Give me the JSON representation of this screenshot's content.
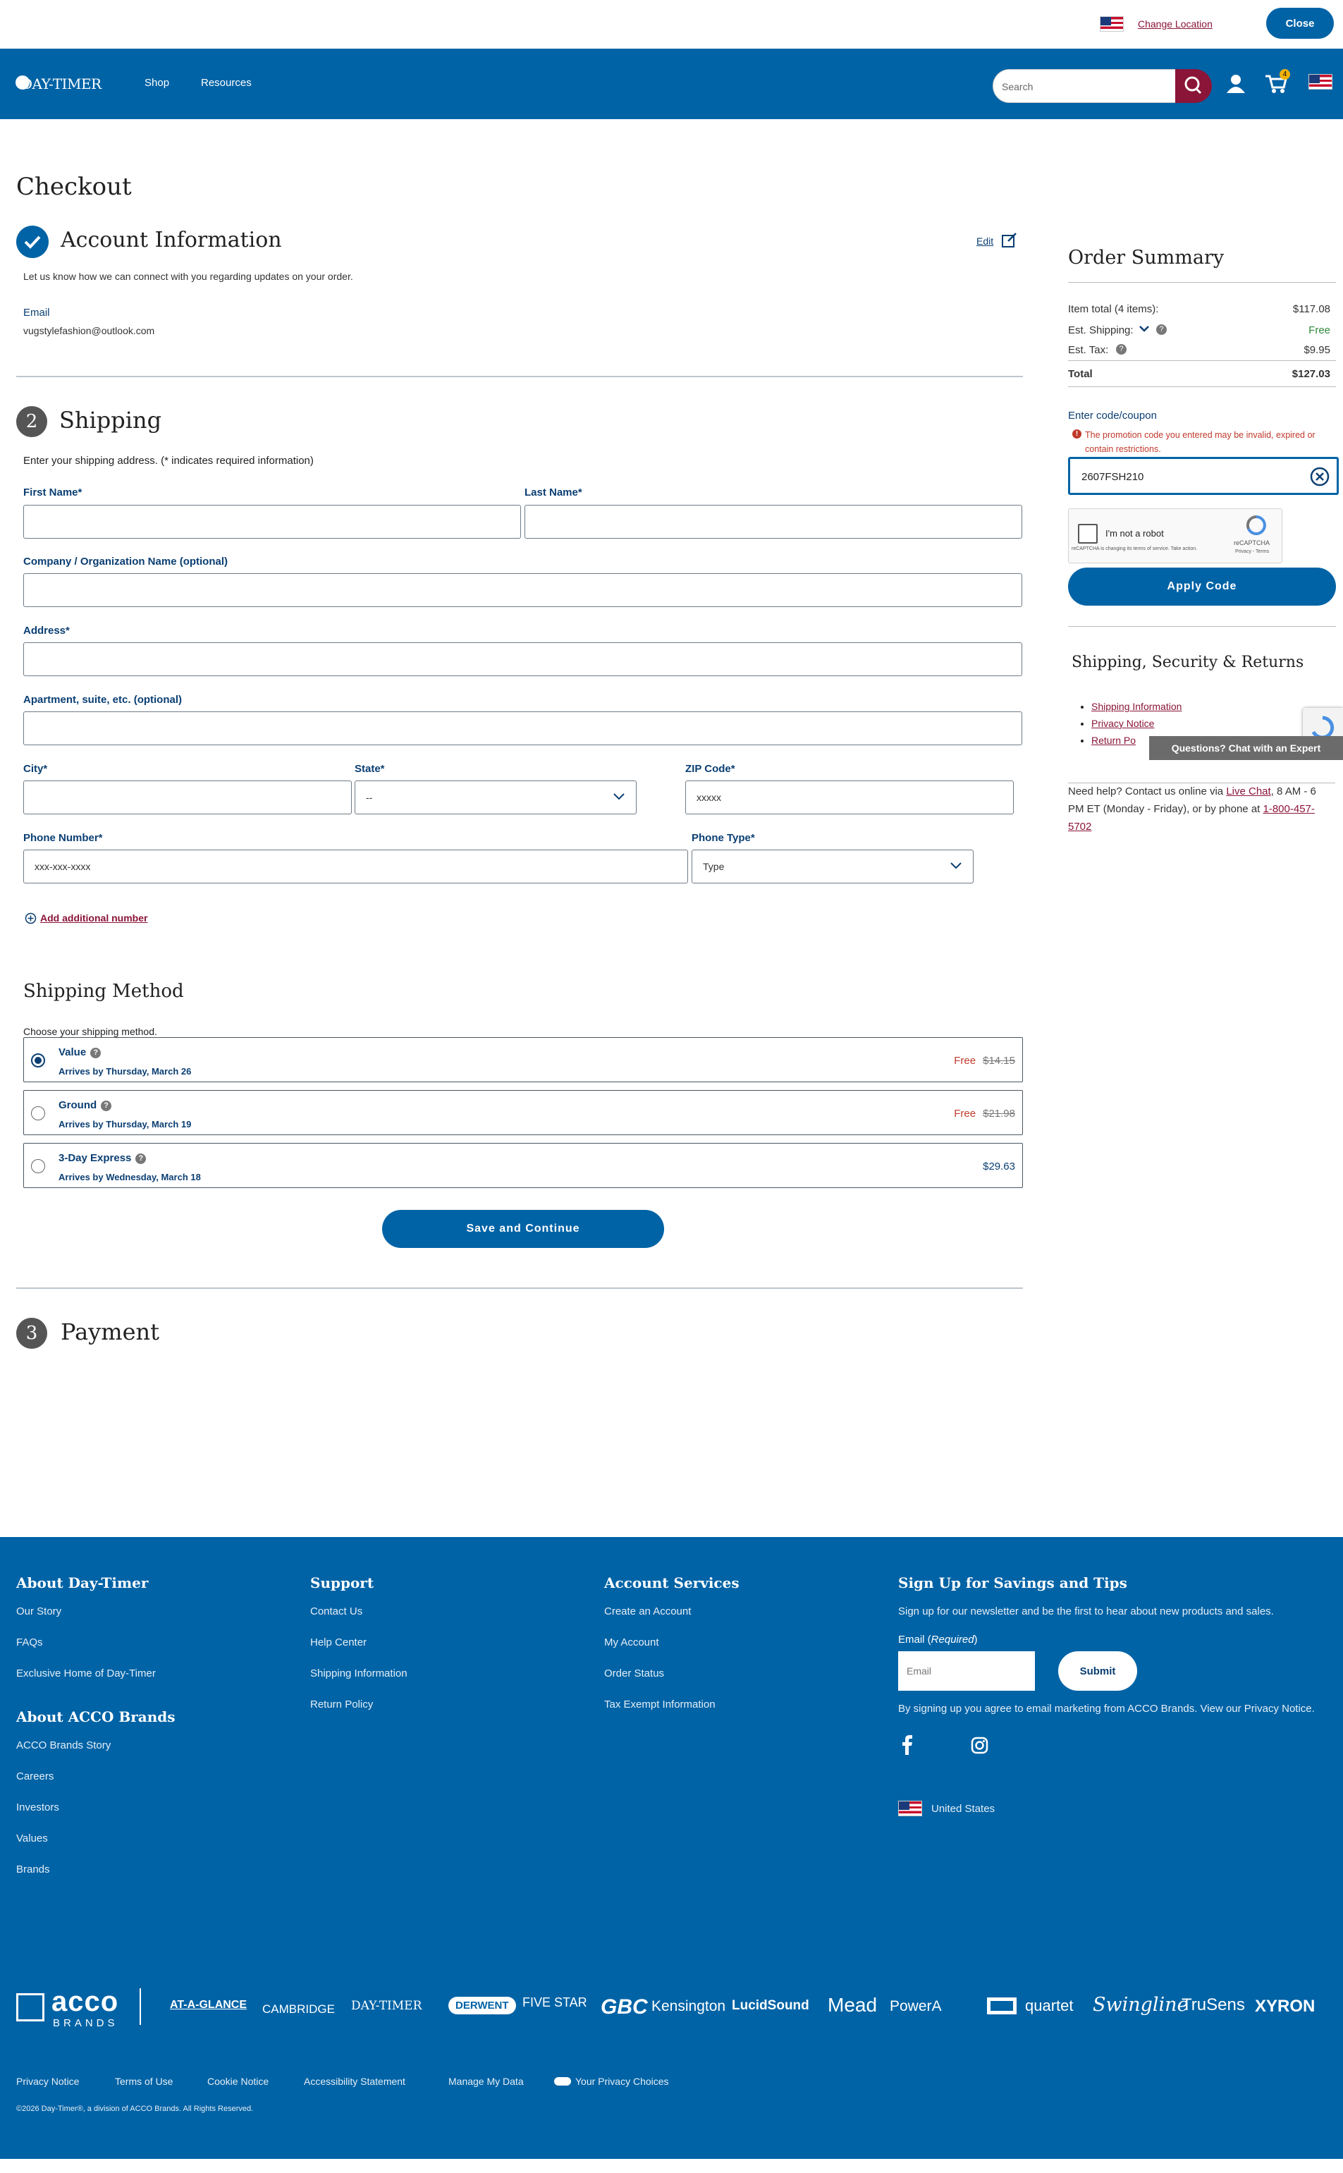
{
  "topbar": {
    "change_location": "Change Location",
    "close": "Close"
  },
  "nav": {
    "logo": "DAY-TIMER",
    "shop": "Shop",
    "resources": "Resources",
    "search_placeholder": "Search",
    "cart_count": "4"
  },
  "page_title": "Checkout",
  "account": {
    "title": "Account Information",
    "edit": "Edit",
    "intro": "Let us know how we can connect with you regarding updates on your order.",
    "email_label": "Email",
    "email_value": "vugstylefashion@outlook.com"
  },
  "shipping": {
    "step": "2",
    "title": "Shipping",
    "intro": "Enter your shipping address. (* indicates required information)",
    "first_name": "First Name*",
    "last_name": "Last Name*",
    "company": "Company / Organization Name (optional)",
    "address": "Address*",
    "apartment": "Apartment, suite, etc. (optional)",
    "city": "City*",
    "state": "State*",
    "state_value": "--",
    "zip": "ZIP Code*",
    "zip_placeholder": "xxxxx",
    "phone": "Phone Number*",
    "phone_placeholder": "xxx-xxx-xxxx",
    "phone_type": "Phone Type*",
    "phone_type_value": "Type",
    "add_number": "Add additional number"
  },
  "shipping_method": {
    "title": "Shipping Method",
    "intro": "Choose your shipping method.",
    "methods": [
      {
        "name": "Value",
        "arrives": "Arrives by Thursday, March 26",
        "free": "Free",
        "old_price": "$14.15",
        "selected": true
      },
      {
        "name": "Ground",
        "arrives": "Arrives by Thursday, March 19",
        "free": "Free",
        "old_price": "$21.98",
        "selected": false
      },
      {
        "name": "3-Day Express",
        "arrives": "Arrives by Wednesday, March 18",
        "price": "$29.63",
        "selected": false
      }
    ],
    "save": "Save and Continue"
  },
  "payment": {
    "step": "3",
    "title": "Payment"
  },
  "summary": {
    "title": "Order Summary",
    "rows": [
      {
        "label": "Item total (4 items):",
        "value": "$117.08"
      },
      {
        "label": "Est. Shipping:",
        "value": "Free"
      },
      {
        "label": "Est. Tax:",
        "value": "$9.95"
      },
      {
        "label": "Total",
        "value": "$127.03"
      }
    ],
    "coupon_label": "Enter code/coupon",
    "coupon_error": "The promotion code you entered may be invalid, expired or contain restrictions.",
    "coupon_value": "2607FSH210",
    "captcha_label": "I'm not a robot",
    "captcha_brand": "reCAPTCHA",
    "captcha_note": "reCAPTCHA is changing its terms of service. Take action.",
    "captcha_links": "Privacy - Terms",
    "apply": "Apply Code",
    "ssr_title": "Shipping, Security & Returns",
    "ssr_links": [
      "Shipping Information",
      "Privacy Notice",
      "Return Po"
    ],
    "chat": "Questions? Chat with an Expert",
    "help_pre": "Need help? Contact us online via ",
    "help_live": "Live Chat",
    "help_mid": ", 8 AM - 6 PM ET (Monday - Friday), or by phone at ",
    "help_phone": "1-800-457-5702"
  },
  "footer": {
    "about": {
      "title": "About Day-Timer",
      "links": [
        "Our Story",
        "FAQs",
        "Exclusive Home of Day-Timer"
      ]
    },
    "acco": {
      "title": "About ACCO Brands",
      "links": [
        "ACCO Brands Story",
        "Careers",
        "Investors",
        "Values",
        "Brands"
      ]
    },
    "support": {
      "title": "Support",
      "links": [
        "Contact Us",
        "Help Center",
        "Shipping Information",
        "Return Policy"
      ]
    },
    "account": {
      "title": "Account Services",
      "links": [
        "Create an Account",
        "My Account",
        "Order Status",
        "Tax Exempt Information"
      ]
    },
    "signup": {
      "title": "Sign Up for Savings and Tips",
      "text": "Sign up for our newsletter and be the first to hear about new products and sales.",
      "email_label": "Email (",
      "email_req": "Required",
      "email_close": ")",
      "email_placeholder": "Email",
      "submit": "Submit",
      "consent": "By signing up you agree to email marketing from ACCO Brands. View our Privacy Notice.",
      "country": "United States"
    },
    "brands": {
      "acco": "acco",
      "acco_sub": "BRANDS",
      "list": [
        "AT-A-GLANCE",
        "CAMBRIDGE",
        "DAY-TIMER",
        "DERWENT",
        "FIVE STAR",
        "GBC",
        "Kensington",
        "LucidSound",
        "Mead",
        "PowerA",
        "quartet",
        "Swingline",
        "TruSens",
        "XYRON"
      ]
    },
    "bottom": [
      "Privacy Notice",
      "Terms of Use",
      "Cookie Notice",
      "Accessibility Statement",
      "Manage My Data",
      "Your Privacy Choices"
    ],
    "copyright": "©2026 Day-Timer®, a division of ACCO Brands. All Rights Reserved."
  }
}
